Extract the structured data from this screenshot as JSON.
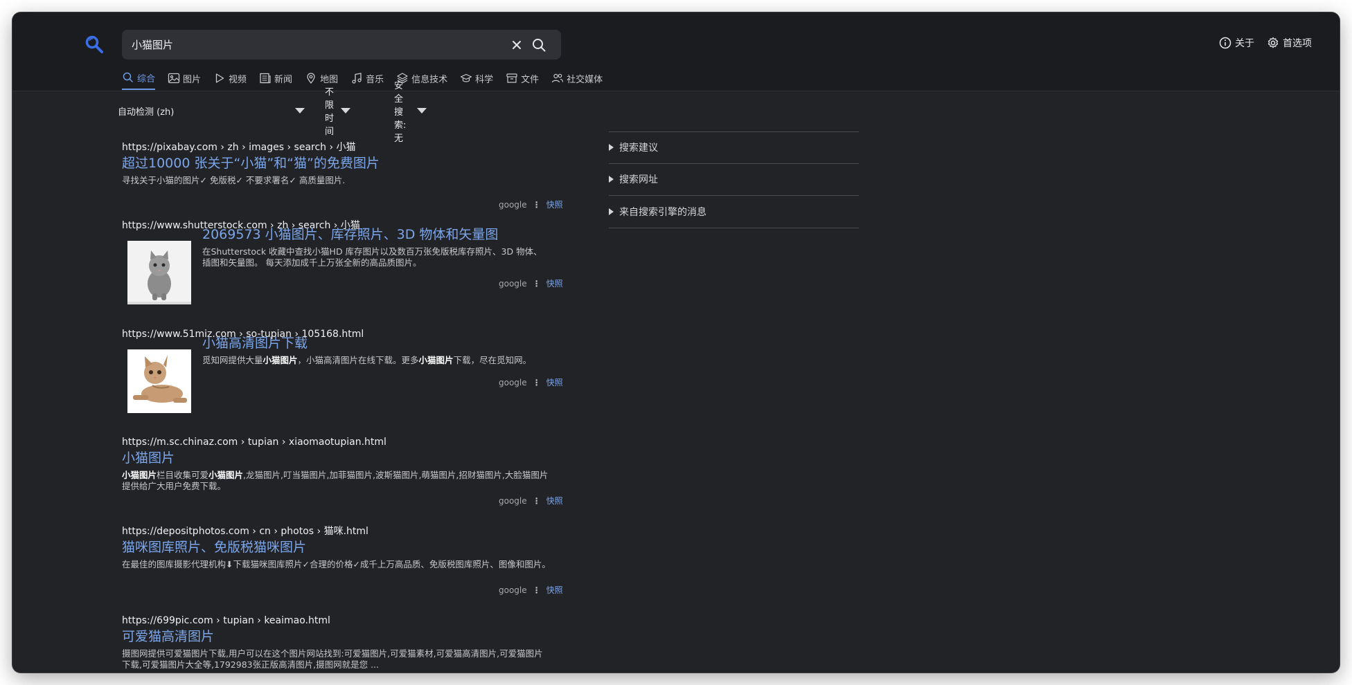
{
  "search": {
    "query": "小猫图片"
  },
  "header": {
    "about": "关于",
    "preferences": "首选项"
  },
  "tabs": [
    {
      "label": "综合",
      "icon": "search-icon"
    },
    {
      "label": "图片",
      "icon": "image-icon"
    },
    {
      "label": "视频",
      "icon": "play-icon"
    },
    {
      "label": "新闻",
      "icon": "newspaper-icon"
    },
    {
      "label": "地图",
      "icon": "map-pin-icon"
    },
    {
      "label": "音乐",
      "icon": "music-icon"
    },
    {
      "label": "信息技术",
      "icon": "layers-icon"
    },
    {
      "label": "科学",
      "icon": "graduation-cap-icon"
    },
    {
      "label": "文件",
      "icon": "archive-icon"
    },
    {
      "label": "社交媒体",
      "icon": "users-icon"
    }
  ],
  "filters": {
    "language": "自动检测 (zh)",
    "time": "不限时间",
    "safe": "安全搜索: 无"
  },
  "results": [
    {
      "url": "https://pixabay.com  › zh › images › search › 小猫",
      "title": "超过10000 张关于“小猫”和“猫”的免费图片",
      "snippet": "寻找关于小猫的图片✓ 免版税✓ 不要求署名✓ 高质量图片.",
      "engine": "google",
      "cache": "快照"
    },
    {
      "url": "https://www.shutterstock.com  › zh › search › 小猫",
      "title": "2069573 小猫图片、库存照片、3D 物体和矢量图",
      "snippet": "在Shutterstock 收藏中查找小猫HD 库存图片以及数百万张免版税库存照片、3D 物体、插图和矢量图。 每天添加成千上万张全新的高品质图片。",
      "engine": "google",
      "cache": "快照"
    },
    {
      "url": "https://www.51miz.com  › so-tupian › 105168.html",
      "title": "小猫高清图片下载",
      "snippet_a": "觅知网提供大量",
      "snippet_b": "小猫图片",
      "snippet_c": "，小猫高清图片在线下载。更多",
      "snippet_d": "小猫图片",
      "snippet_e": "下载，尽在觅知网。",
      "engine": "google",
      "cache": "快照"
    },
    {
      "url": "https://m.sc.chinaz.com  › tupian › xiaomaotupian.html",
      "title": "小猫图片",
      "snippet_a": "小猫图片",
      "snippet_b": "栏目收集可爱",
      "snippet_c": "小猫图片",
      "snippet_d": ",龙猫图片,叮当猫图片,加菲猫图片,波斯猫图片,萌猫图片,招财猫图片,大脸猫图片提供给广大用户免费下载。",
      "engine": "google",
      "cache": "快照"
    },
    {
      "url": "https://depositphotos.com  › cn › photos › 猫咪.html",
      "title": "猫咪图库照片、免版税猫咪图片",
      "snippet": "在最佳的图库摄影代理机构⬇下载猫咪图库照片✓合理的价格✓成千上万高品质、免版税图库照片、图像和图片。",
      "engine": "google",
      "cache": "快照"
    },
    {
      "url": "https://699pic.com  › tupian › keaimao.html",
      "title": "可爱猫高清图片",
      "snippet": "摄图网提供可爱猫图片下载,用户可以在这个图片网站找到:可爱猫图片,可爱猫素材,可爱猫高清图片,可爱猫图片下载,可爱猫图片大全等,1792983张正版高清图片,摄图网就是您 ..."
    }
  ],
  "side_panel": {
    "suggestions": "搜索建议",
    "search_url": "搜索网址",
    "engine_messages": "来自搜索引擎的消息"
  }
}
